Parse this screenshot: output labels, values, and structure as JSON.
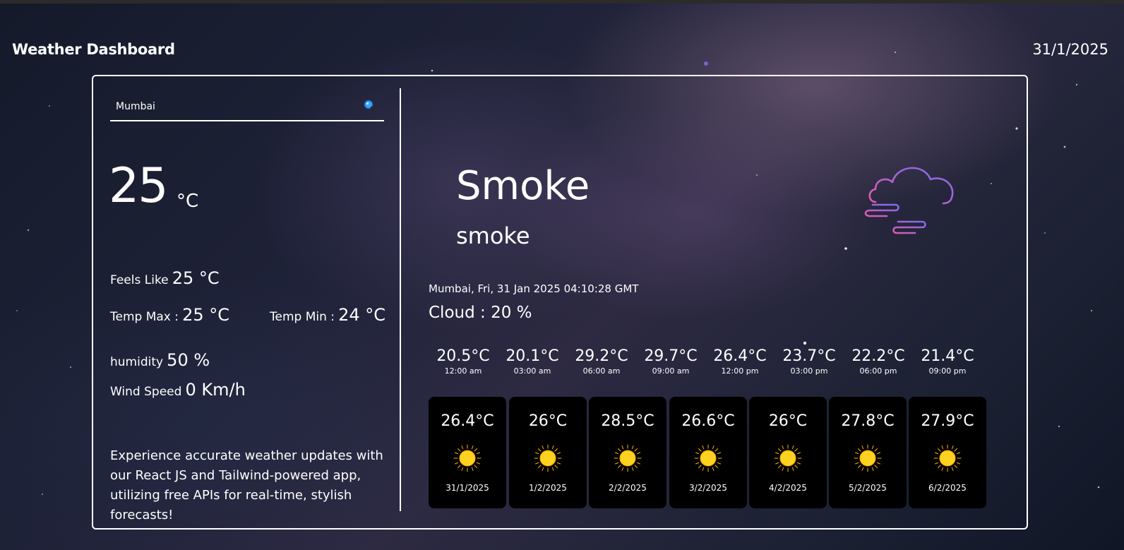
{
  "header": {
    "app_title": "Weather Dashboard",
    "date": "31/1/2025"
  },
  "search": {
    "value": "Mumbai",
    "icon": "search-icon"
  },
  "current": {
    "temp": "25",
    "unit": "°C",
    "feels_like_label": "Feels Like",
    "feels_like_value": "25 °C",
    "temp_max_label": "Temp Max :",
    "temp_max_value": "25 °C",
    "temp_min_label": "Temp Min :",
    "temp_min_value": "24 °C",
    "humidity_label": "humidity",
    "humidity_value": "50 %",
    "wind_label": "Wind Speed",
    "wind_value": "0 Km/h",
    "blurb": "Experience accurate weather updates with our React JS and Tailwind-powered app, utilizing free APIs for real-time, stylish forecasts!"
  },
  "condition": {
    "main": "Smoke",
    "description": "smoke",
    "icon": "smoke-cloud-icon",
    "location_time": "Mumbai, Fri, 31 Jan 2025 04:10:28 GMT",
    "cloud": "Cloud : 20 %"
  },
  "hourly": [
    {
      "temp": "20.5°C",
      "time": "12:00 am"
    },
    {
      "temp": "20.1°C",
      "time": "03:00 am"
    },
    {
      "temp": "29.2°C",
      "time": "06:00 am"
    },
    {
      "temp": "29.7°C",
      "time": "09:00 am"
    },
    {
      "temp": "26.4°C",
      "time": "12:00 pm"
    },
    {
      "temp": "23.7°C",
      "time": "03:00 pm"
    },
    {
      "temp": "22.2°C",
      "time": "06:00 pm"
    },
    {
      "temp": "21.4°C",
      "time": "09:00 pm"
    }
  ],
  "daily": [
    {
      "temp": "26.4°C",
      "date": "31/1/2025",
      "icon": "sun-icon"
    },
    {
      "temp": "26°C",
      "date": "1/2/2025",
      "icon": "sun-icon"
    },
    {
      "temp": "28.5°C",
      "date": "2/2/2025",
      "icon": "sun-icon"
    },
    {
      "temp": "26.6°C",
      "date": "3/2/2025",
      "icon": "sun-icon"
    },
    {
      "temp": "26°C",
      "date": "4/2/2025",
      "icon": "sun-icon"
    },
    {
      "temp": "27.8°C",
      "date": "5/2/2025",
      "icon": "sun-icon"
    },
    {
      "temp": "27.9°C",
      "date": "6/2/2025",
      "icon": "sun-icon"
    }
  ],
  "colors": {
    "text": "#ffffff",
    "card": "#000000",
    "sun": "#ffd21f",
    "icon_gradient_start": "#e05ab0",
    "icon_gradient_end": "#7a6cf0"
  }
}
